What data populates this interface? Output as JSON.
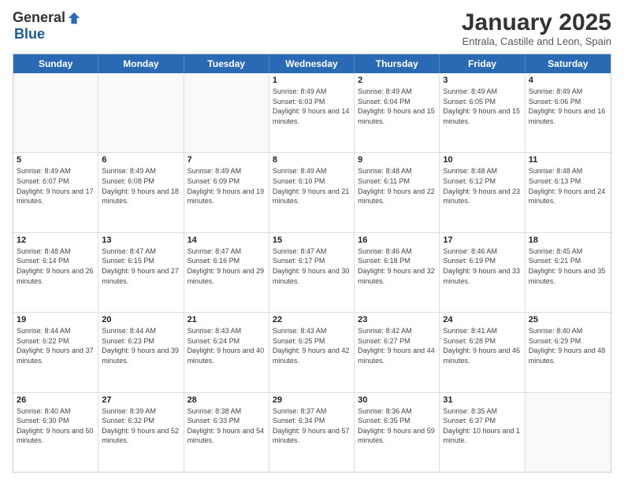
{
  "logo": {
    "general": "General",
    "blue": "Blue"
  },
  "title": "January 2025",
  "location": "Entrala, Castille and Leon, Spain",
  "days_header": [
    "Sunday",
    "Monday",
    "Tuesday",
    "Wednesday",
    "Thursday",
    "Friday",
    "Saturday"
  ],
  "weeks": [
    [
      {
        "day": "",
        "sunrise": "",
        "sunset": "",
        "daylight": ""
      },
      {
        "day": "",
        "sunrise": "",
        "sunset": "",
        "daylight": ""
      },
      {
        "day": "",
        "sunrise": "",
        "sunset": "",
        "daylight": ""
      },
      {
        "day": "1",
        "sunrise": "Sunrise: 8:49 AM",
        "sunset": "Sunset: 6:03 PM",
        "daylight": "Daylight: 9 hours and 14 minutes."
      },
      {
        "day": "2",
        "sunrise": "Sunrise: 8:49 AM",
        "sunset": "Sunset: 6:04 PM",
        "daylight": "Daylight: 9 hours and 15 minutes."
      },
      {
        "day": "3",
        "sunrise": "Sunrise: 8:49 AM",
        "sunset": "Sunset: 6:05 PM",
        "daylight": "Daylight: 9 hours and 15 minutes."
      },
      {
        "day": "4",
        "sunrise": "Sunrise: 8:49 AM",
        "sunset": "Sunset: 6:06 PM",
        "daylight": "Daylight: 9 hours and 16 minutes."
      }
    ],
    [
      {
        "day": "5",
        "sunrise": "Sunrise: 8:49 AM",
        "sunset": "Sunset: 6:07 PM",
        "daylight": "Daylight: 9 hours and 17 minutes."
      },
      {
        "day": "6",
        "sunrise": "Sunrise: 8:49 AM",
        "sunset": "Sunset: 6:08 PM",
        "daylight": "Daylight: 9 hours and 18 minutes."
      },
      {
        "day": "7",
        "sunrise": "Sunrise: 8:49 AM",
        "sunset": "Sunset: 6:09 PM",
        "daylight": "Daylight: 9 hours and 19 minutes."
      },
      {
        "day": "8",
        "sunrise": "Sunrise: 8:49 AM",
        "sunset": "Sunset: 6:10 PM",
        "daylight": "Daylight: 9 hours and 21 minutes."
      },
      {
        "day": "9",
        "sunrise": "Sunrise: 8:48 AM",
        "sunset": "Sunset: 6:11 PM",
        "daylight": "Daylight: 9 hours and 22 minutes."
      },
      {
        "day": "10",
        "sunrise": "Sunrise: 8:48 AM",
        "sunset": "Sunset: 6:12 PM",
        "daylight": "Daylight: 9 hours and 23 minutes."
      },
      {
        "day": "11",
        "sunrise": "Sunrise: 8:48 AM",
        "sunset": "Sunset: 6:13 PM",
        "daylight": "Daylight: 9 hours and 24 minutes."
      }
    ],
    [
      {
        "day": "12",
        "sunrise": "Sunrise: 8:48 AM",
        "sunset": "Sunset: 6:14 PM",
        "daylight": "Daylight: 9 hours and 26 minutes."
      },
      {
        "day": "13",
        "sunrise": "Sunrise: 8:47 AM",
        "sunset": "Sunset: 6:15 PM",
        "daylight": "Daylight: 9 hours and 27 minutes."
      },
      {
        "day": "14",
        "sunrise": "Sunrise: 8:47 AM",
        "sunset": "Sunset: 6:16 PM",
        "daylight": "Daylight: 9 hours and 29 minutes."
      },
      {
        "day": "15",
        "sunrise": "Sunrise: 8:47 AM",
        "sunset": "Sunset: 6:17 PM",
        "daylight": "Daylight: 9 hours and 30 minutes."
      },
      {
        "day": "16",
        "sunrise": "Sunrise: 8:46 AM",
        "sunset": "Sunset: 6:18 PM",
        "daylight": "Daylight: 9 hours and 32 minutes."
      },
      {
        "day": "17",
        "sunrise": "Sunrise: 8:46 AM",
        "sunset": "Sunset: 6:19 PM",
        "daylight": "Daylight: 9 hours and 33 minutes."
      },
      {
        "day": "18",
        "sunrise": "Sunrise: 8:45 AM",
        "sunset": "Sunset: 6:21 PM",
        "daylight": "Daylight: 9 hours and 35 minutes."
      }
    ],
    [
      {
        "day": "19",
        "sunrise": "Sunrise: 8:44 AM",
        "sunset": "Sunset: 6:22 PM",
        "daylight": "Daylight: 9 hours and 37 minutes."
      },
      {
        "day": "20",
        "sunrise": "Sunrise: 8:44 AM",
        "sunset": "Sunset: 6:23 PM",
        "daylight": "Daylight: 9 hours and 39 minutes."
      },
      {
        "day": "21",
        "sunrise": "Sunrise: 8:43 AM",
        "sunset": "Sunset: 6:24 PM",
        "daylight": "Daylight: 9 hours and 40 minutes."
      },
      {
        "day": "22",
        "sunrise": "Sunrise: 8:43 AM",
        "sunset": "Sunset: 6:25 PM",
        "daylight": "Daylight: 9 hours and 42 minutes."
      },
      {
        "day": "23",
        "sunrise": "Sunrise: 8:42 AM",
        "sunset": "Sunset: 6:27 PM",
        "daylight": "Daylight: 9 hours and 44 minutes."
      },
      {
        "day": "24",
        "sunrise": "Sunrise: 8:41 AM",
        "sunset": "Sunset: 6:28 PM",
        "daylight": "Daylight: 9 hours and 46 minutes."
      },
      {
        "day": "25",
        "sunrise": "Sunrise: 8:40 AM",
        "sunset": "Sunset: 6:29 PM",
        "daylight": "Daylight: 9 hours and 48 minutes."
      }
    ],
    [
      {
        "day": "26",
        "sunrise": "Sunrise: 8:40 AM",
        "sunset": "Sunset: 6:30 PM",
        "daylight": "Daylight: 9 hours and 50 minutes."
      },
      {
        "day": "27",
        "sunrise": "Sunrise: 8:39 AM",
        "sunset": "Sunset: 6:32 PM",
        "daylight": "Daylight: 9 hours and 52 minutes."
      },
      {
        "day": "28",
        "sunrise": "Sunrise: 8:38 AM",
        "sunset": "Sunset: 6:33 PM",
        "daylight": "Daylight: 9 hours and 54 minutes."
      },
      {
        "day": "29",
        "sunrise": "Sunrise: 8:37 AM",
        "sunset": "Sunset: 6:34 PM",
        "daylight": "Daylight: 9 hours and 57 minutes."
      },
      {
        "day": "30",
        "sunrise": "Sunrise: 8:36 AM",
        "sunset": "Sunset: 6:35 PM",
        "daylight": "Daylight: 9 hours and 59 minutes."
      },
      {
        "day": "31",
        "sunrise": "Sunrise: 8:35 AM",
        "sunset": "Sunset: 6:37 PM",
        "daylight": "Daylight: 10 hours and 1 minute."
      },
      {
        "day": "",
        "sunrise": "",
        "sunset": "",
        "daylight": ""
      }
    ]
  ]
}
